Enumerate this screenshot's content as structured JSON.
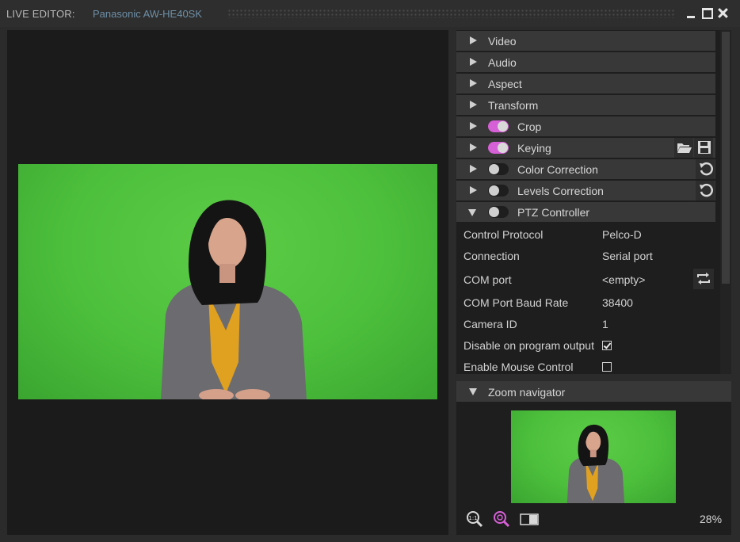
{
  "titlebar": {
    "app_label": "LIVE EDITOR:",
    "source_name": "Panasonic AW-HE40SK"
  },
  "sections": [
    {
      "label": "Video",
      "expanded": false
    },
    {
      "label": "Audio",
      "expanded": false
    },
    {
      "label": "Aspect",
      "expanded": false
    },
    {
      "label": "Transform",
      "expanded": false
    },
    {
      "label": "Crop",
      "expanded": false,
      "toggle": "on"
    },
    {
      "label": "Keying",
      "expanded": false,
      "toggle": "on"
    },
    {
      "label": "Color Correction",
      "expanded": false,
      "toggle": "off"
    },
    {
      "label": "Levels Correction",
      "expanded": false,
      "toggle": "off"
    },
    {
      "label": "PTZ Controller",
      "expanded": true,
      "toggle": "off"
    }
  ],
  "ptz": {
    "control_protocol": {
      "name": "Control Protocol",
      "value": "Pelco-D"
    },
    "connection": {
      "name": "Connection",
      "value": "Serial port"
    },
    "com_port": {
      "name": "COM port",
      "value": "<empty>"
    },
    "baud_rate": {
      "name": "COM Port Baud Rate",
      "value": "38400"
    },
    "camera_id": {
      "name": "Camera ID",
      "value": "1"
    },
    "disable_on_program": {
      "name": "Disable on program output",
      "checked": true
    },
    "enable_mouse": {
      "name": "Enable Mouse Control",
      "checked": false
    }
  },
  "zoom_navigator": {
    "label": "Zoom navigator",
    "zoom_percent": "28%"
  },
  "colors": {
    "accent": "#d660d6",
    "chroma_green": "#4cbf3c",
    "panel_bg": "#1e1e1e",
    "header_bg": "#383838"
  },
  "icons": {
    "keying_open": "folder-open-icon",
    "keying_save": "save-icon",
    "reset": "reset-icon",
    "com_refresh": "refresh-icon",
    "zoom_fit": "zoom-1to1-icon",
    "zoom_magnify": "zoom-magnify-icon",
    "zoom_split": "split-view-icon"
  }
}
